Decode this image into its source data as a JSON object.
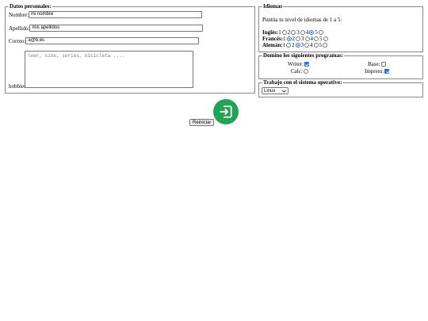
{
  "personal": {
    "legend": "Datos personales:",
    "nombre_label": "Nombre:",
    "nombre_value": "mi nombre",
    "apellido_label": "Apellido:",
    "apellido_value": "mis apellidos",
    "correo_label": "Correo:",
    "correo_value": "a@b.es",
    "hobbies_label": "hobbies",
    "hobbies_placeholder": "leer, cine, series, bicicleta ...."
  },
  "idiomas": {
    "legend": "Idiomas",
    "instructions": "Puntúa tu nivel de idiomas de 1 a 5:",
    "languages": [
      {
        "name": "Inglés:",
        "selected": 4
      },
      {
        "name": "Francés:",
        "selected": 2
      },
      {
        "name": "Alemán:",
        "selected": 3
      }
    ],
    "levels": [
      "1",
      "2",
      "3",
      "4",
      "5"
    ]
  },
  "programas": {
    "legend": "Domino los siguientes programas:",
    "writer_label": "Writer:",
    "writer_checked": true,
    "base_label": "Base:",
    "base_checked": false,
    "calc_label": "Calc:",
    "calc_checked": false,
    "impress_label": "Impress:",
    "impress_checked": true
  },
  "sistema": {
    "legend": "Trabajo con el sistema operativo:",
    "selected": "Linux"
  },
  "actions": {
    "reset_label": "Reiniciar",
    "submit_icon": "login-enter-icon",
    "submit_color": "#23a455"
  },
  "colors": {
    "accent": "#1a73e8",
    "border": "#8a8a8a"
  }
}
